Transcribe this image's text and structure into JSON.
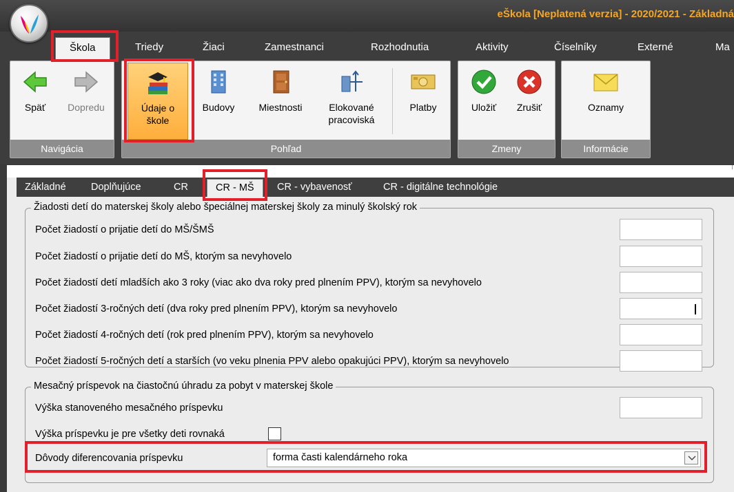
{
  "window": {
    "title": "eŠkola [Neplatená verzia] - 2020/2021 - Základná"
  },
  "ribbon_tabs": [
    "Škola",
    "Triedy",
    "Žiaci",
    "Zamestnanci",
    "Rozhodnutia",
    "Aktivity",
    "Číselníky",
    "Externé",
    "Ma"
  ],
  "ribbon_groups": {
    "navigacia": {
      "label": "Navigácia",
      "buttons": [
        "Späť",
        "Dopredu"
      ]
    },
    "pohlad": {
      "label": "Pohľad",
      "buttons": [
        "Údaje o",
        "škole",
        "Budovy",
        "Miestnosti",
        "Elokované",
        "pracoviská",
        "Platby"
      ]
    },
    "zmeny": {
      "label": "Zmeny",
      "buttons": [
        "Uložiť",
        "Zrušiť"
      ]
    },
    "informacie": {
      "label": "Informácie",
      "buttons": [
        "Oznamy"
      ]
    }
  },
  "subtabs": [
    "Základné",
    "Doplňujúce",
    "CR",
    "CR - MŠ",
    "CR - vybavenosť",
    "CR - digitálne technológie"
  ],
  "section1": {
    "legend": "Žiadosti detí do materskej školy alebo špeciálnej materskej školy za minulý školský rok",
    "rows": [
      "Počet žiadostí o prijatie detí do MŠ/ŠMŠ",
      "Počet žiadostí o prijatie detí do MŠ, ktorým sa nevyhovelo",
      "Počet žiadostí detí mladších ako 3 roky (viac ako dva roky pred plnením PPV), ktorým sa nevyhovelo",
      "Počet žiadostí 3-ročných detí (dva roky pred plnením PPV), ktorým sa nevyhovelo",
      "Počet žiadostí 4-ročných detí (rok pred plnením PPV), ktorým sa nevyhovelo",
      "Počet žiadostí 5-ročných detí a starších (vo veku plnenia PPV alebo opakujúci PPV), ktorým sa nevyhovelo"
    ]
  },
  "section2": {
    "legend": "Mesačný príspevok na čiastočnú úhradu za pobyt v materskej škole",
    "amount_label": "Výška stanoveného mesačného príspevku",
    "equal_label": "Výška príspevku je pre všetky deti rovnaká",
    "reason_label": "Dôvody diferencovania príspevku",
    "reason_value": "forma časti kalendárneho roka"
  },
  "colors": {
    "accent_highlight": "#e0202a",
    "title_text": "#f5a623"
  }
}
